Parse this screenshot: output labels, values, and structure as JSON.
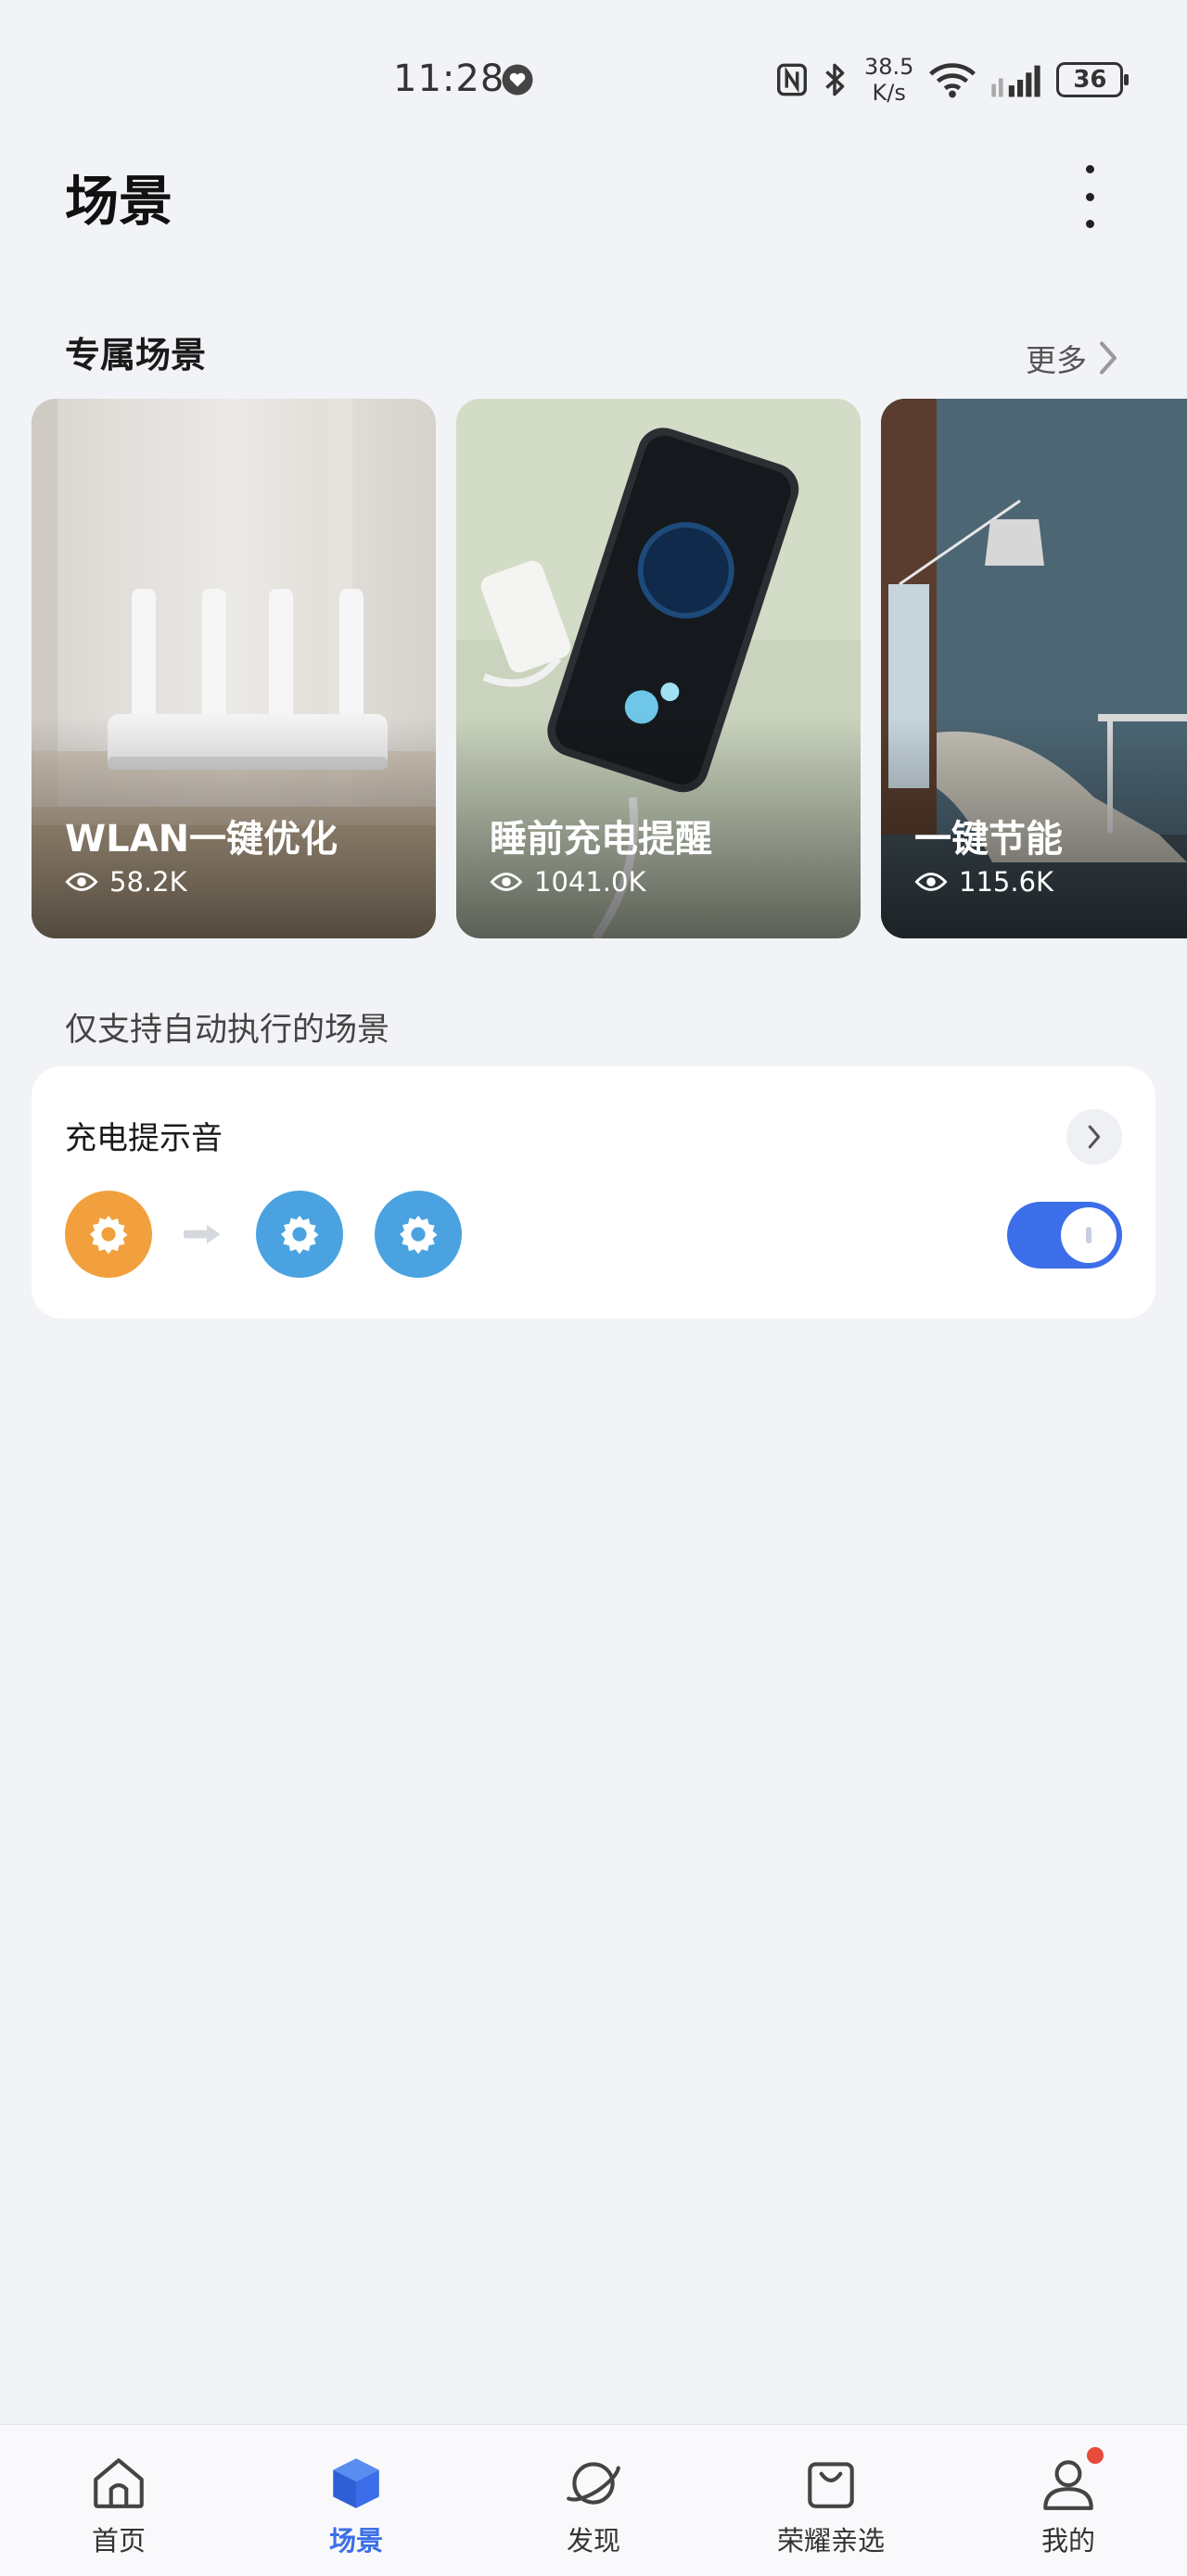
{
  "status_bar": {
    "time": "11:28",
    "net_speed_value": "38.5",
    "net_speed_unit": "K/s",
    "battery": "36",
    "icons": [
      "heart-icon",
      "nfc-icon",
      "bluetooth-icon",
      "wifi-icon",
      "signal-icon",
      "battery-icon"
    ]
  },
  "header": {
    "title": "场景"
  },
  "exclusive": {
    "title": "专属场景",
    "more_label": "更多",
    "cards": [
      {
        "title": "WLAN一键优化",
        "views": "58.2K"
      },
      {
        "title": "睡前充电提醒",
        "views": "1041.0K"
      },
      {
        "title": "一键节能",
        "views": "115.6K"
      }
    ]
  },
  "auto_section": {
    "title": "仅支持自动执行的场景",
    "scene": {
      "name": "充电提示音",
      "enabled": true
    }
  },
  "bottom_nav": {
    "items": [
      {
        "label": "首页"
      },
      {
        "label": "场景"
      },
      {
        "label": "发现"
      },
      {
        "label": "荣耀亲选"
      },
      {
        "label": "我的"
      }
    ],
    "active_index": 1
  },
  "colors": {
    "accent": "#3b6ee8",
    "trigger_icon": "#f2a03d",
    "action_icon": "#4aa3e0",
    "badge": "#e84a3c"
  }
}
